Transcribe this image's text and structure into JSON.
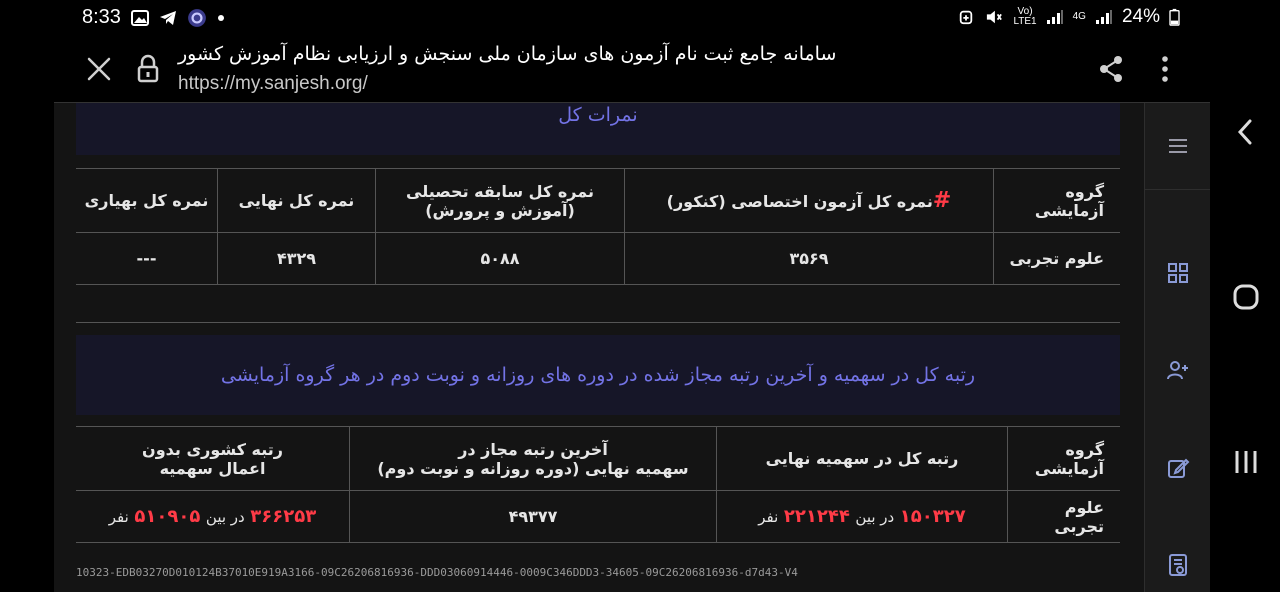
{
  "status_bar": {
    "time": "8:33",
    "network_top": "Vo)",
    "network_bottom": "LTE1",
    "network_gen": "4G",
    "battery": "24%"
  },
  "browser": {
    "title": "سامانه جامع ثبت نام آزمون های سازمان ملی سنجش و ارزیابی نظام آموزش کشور",
    "url": "https://my.sanjesh.org/"
  },
  "grades_section": {
    "header": "نمرات کل",
    "columns": {
      "group": "گروه آزمایشی",
      "hash": "#",
      "exam": "نمره کل آزمون اختصاصی (کنکور)",
      "edu_line1": "نمره کل سابقه تحصیلی",
      "edu_line2": "(آموزش و پرورش)",
      "final": "نمره کل نهایی",
      "spring": "نمره کل بهیاری"
    },
    "row": {
      "group": "علوم تجربی",
      "exam": "۳۵۶۹",
      "edu": "۵۰۸۸",
      "final": "۴۳۲۹",
      "spring": "---"
    }
  },
  "rank_section": {
    "header": "رتبه کل در سهمیه و آخرین رتبه مجاز شده در دوره های روزانه و نوبت دوم در هر گروه آزمایشی",
    "columns": {
      "group": "گروه آزمایشی",
      "rank_quota": "رتبه کل در سهمیه نهایی",
      "last_line1": "آخرین رتبه مجاز در",
      "last_line2": "سهمیه نهایی (دوره روزانه و نوبت دوم)",
      "national_line1": "رتبه کشوری بدون",
      "national_line2": "اعمال سهمیه"
    },
    "row": {
      "group": "علوم تجربی",
      "rank_value": "۱۵۰۳۲۷",
      "rank_between": "در بین",
      "rank_total": "۲۲۱۲۴۴",
      "rank_unit": "نفر",
      "last_allowed": "۴۹۳۷۷",
      "national_value": "۳۶۶۲۵۳",
      "national_between": "در بین",
      "national_total": "۵۱۰۹۰۵",
      "national_unit": "نفر"
    }
  },
  "footer_code": "10323-EDB03270D010124B37010E919A3166-09C26206816936-DDD03060914446-0009C346DDD3-34605-09C26206816936-d7d43-V4",
  "colors": {
    "header_text": "#7373e6",
    "highlight": "#ff3b47"
  }
}
